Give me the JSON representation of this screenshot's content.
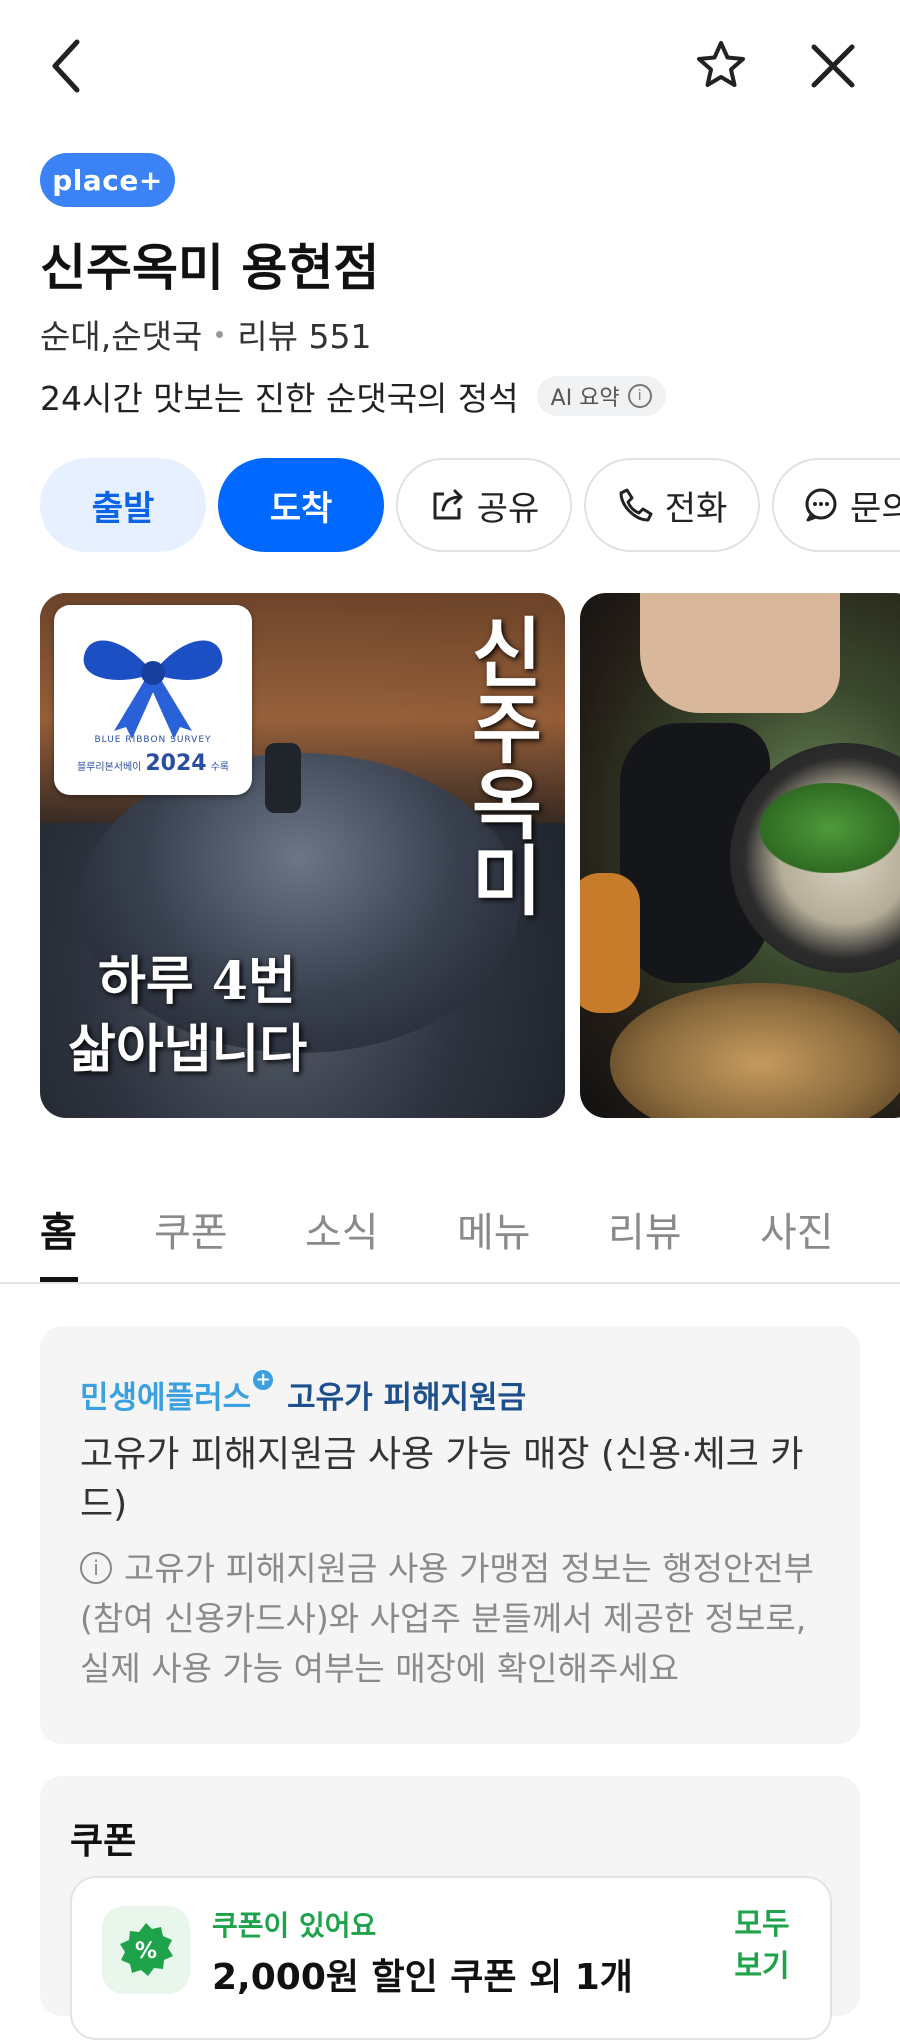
{
  "header": {
    "back_icon": "chevron-left-icon",
    "star_icon": "star-outline-icon",
    "close_icon": "close-icon"
  },
  "place": {
    "badge": "place+",
    "name": "신주옥미 용현점",
    "category": "순대,순댓국",
    "review_label": "리뷰 551",
    "summary": "24시간 맛보는 진한 순댓국의 정석",
    "ai_summary_label": "AI 요약"
  },
  "actions": [
    {
      "label": "출발"
    },
    {
      "label": "도착"
    },
    {
      "label": "공유",
      "icon": "share-icon"
    },
    {
      "label": "전화",
      "icon": "phone-icon"
    },
    {
      "label": "문의",
      "icon": "chat-icon"
    }
  ],
  "photos": {
    "photo1": {
      "ribbon_text": "BLUE RIBBON SURVEY",
      "ribbon_sub": "블루리본서베이",
      "ribbon_year": "2024",
      "ribbon_suffix": "수록",
      "vertical_text": "신주옥미",
      "caption_line1": "하루 4번",
      "caption_line2": "삶아냅니다"
    }
  },
  "tabs": [
    {
      "label": "홈",
      "active": true
    },
    {
      "label": "쿠폰"
    },
    {
      "label": "소식"
    },
    {
      "label": "메뉴"
    },
    {
      "label": "리뷰"
    },
    {
      "label": "사진"
    }
  ],
  "support_card": {
    "brand": "민생에플러스",
    "brand_title": "고유가 피해지원금",
    "headline": "고유가 피해지원금 사용 가능 매장 (신용·체크 카드)",
    "notice": "고유가 피해지원금 사용 가맹점 정보는 행정안전부(참여 신용카드사)와 사업주 분들께서 제공한 정보로, 실제 사용 가능 여부는 매장에 확인해주세요"
  },
  "coupon_card": {
    "title": "쿠폰",
    "status": "쿠폰이 있어요",
    "description": "2,000원 할인 쿠폰 외 1개",
    "view_all": "모두 보기"
  },
  "colors": {
    "accent": "#0068ff",
    "coupon_green": "#1ea34b",
    "brand_blue": "#3aa0e0"
  }
}
